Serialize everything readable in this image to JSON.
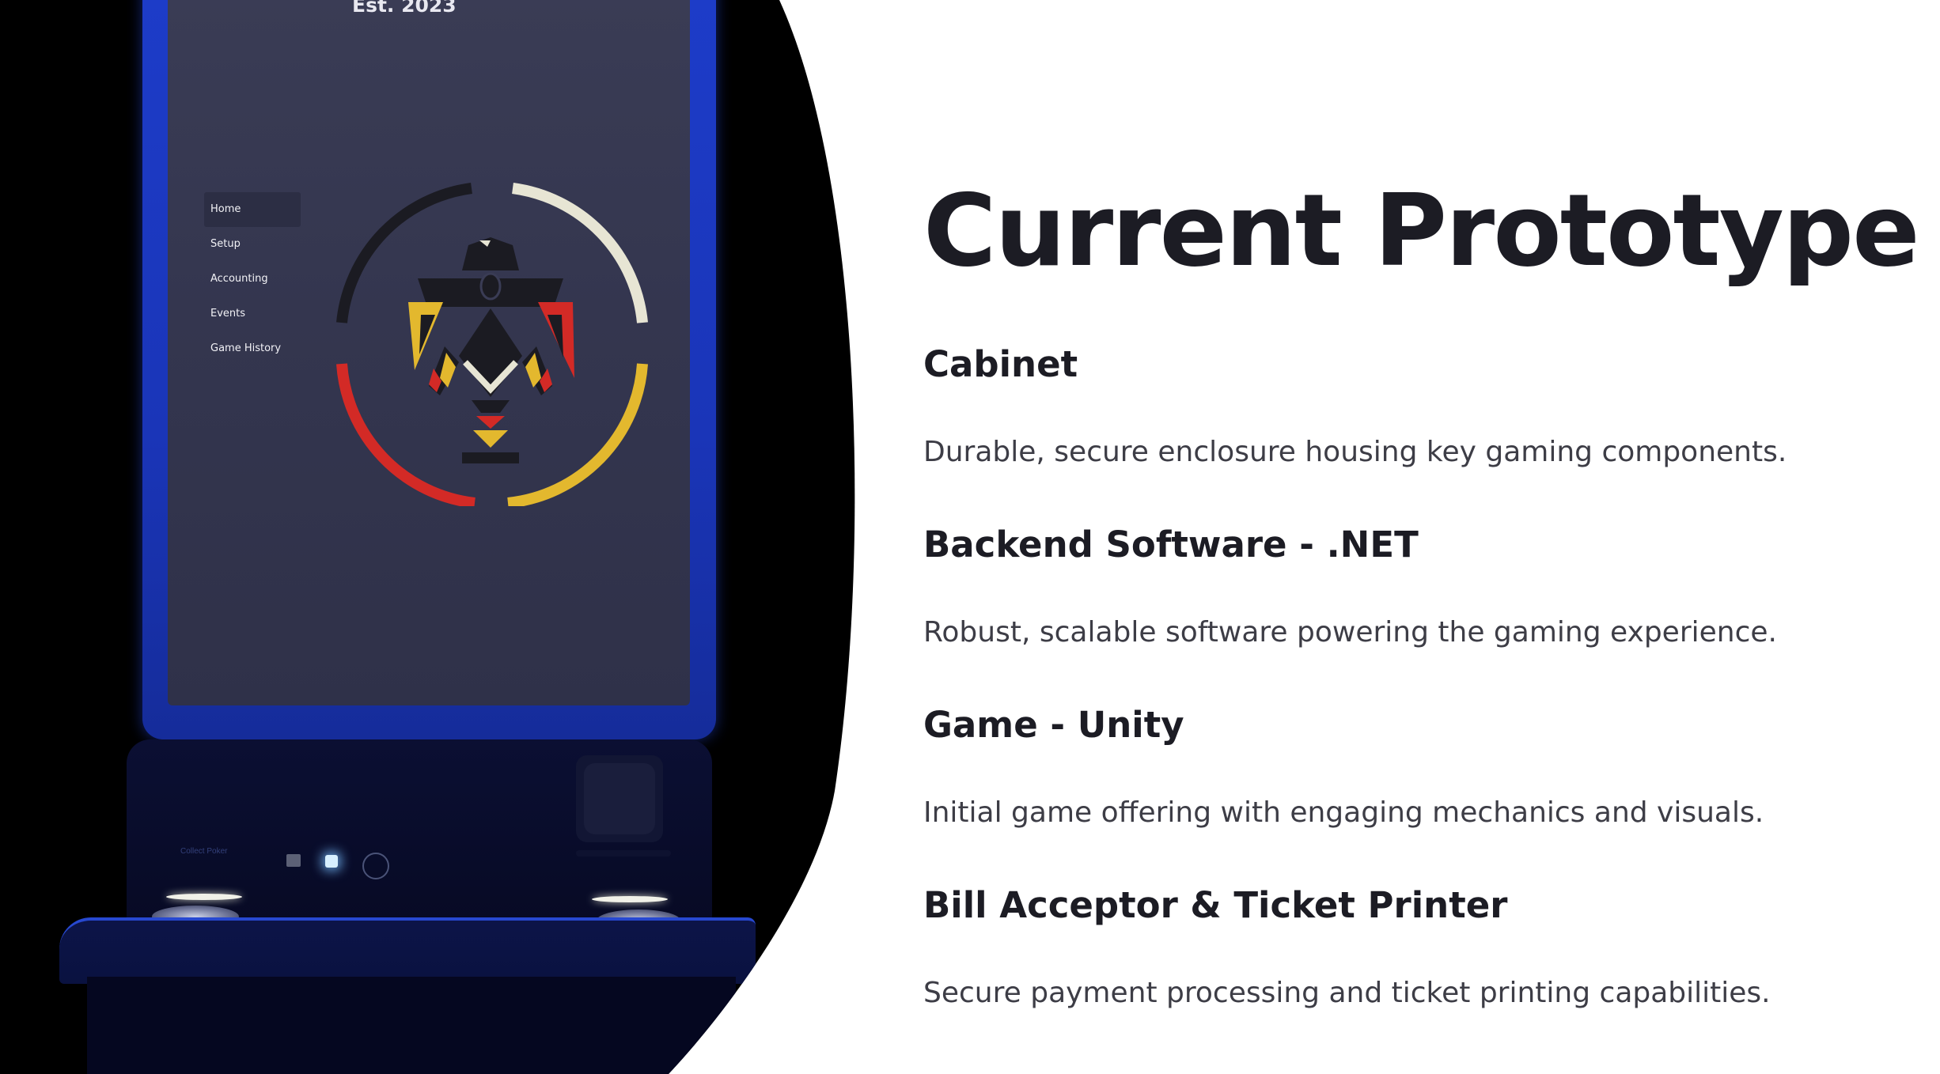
{
  "slide": {
    "title": "Current Prototype",
    "sections": [
      {
        "heading": "Cabinet",
        "body": "Durable, secure enclosure housing key gaming components."
      },
      {
        "heading": "Backend Software - .NET",
        "body": "Robust, scalable software powering the gaming experience."
      },
      {
        "heading": "Game - Unity",
        "body": "Initial game offering with engaging mechanics and visuals."
      },
      {
        "heading": "Bill Acceptor & Ticket Printer",
        "body": "Secure payment processing and ticket printing capabilities."
      }
    ]
  },
  "machine_screen": {
    "est_text": "Est. 2023",
    "menu": [
      "Home",
      "Setup",
      "Accounting",
      "Events",
      "Game History"
    ],
    "active_menu_index": 0,
    "panel_label": "Collect Poker"
  },
  "colors": {
    "cabinet_blue": "#1d3cc9",
    "screen_bg": "#34364f",
    "logo_red": "#d32a26",
    "logo_yellow": "#e3b82e",
    "logo_white": "#e7e5d4",
    "logo_black": "#1b1b22",
    "title_text": "#1c1c24",
    "body_text": "#3d3d46"
  }
}
